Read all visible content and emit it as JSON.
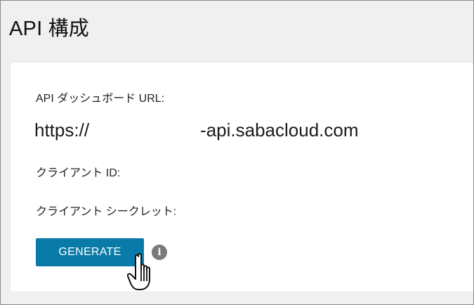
{
  "page": {
    "title": "API 構成"
  },
  "card": {
    "api_dashboard_url_label": "API ダッシュボード URL:",
    "api_dashboard_url_prefix": "https://",
    "api_dashboard_url_suffix": "-api.sabacloud.com",
    "client_id_label": "クライアント ID:",
    "client_secret_label": "クライアント シークレット:"
  },
  "actions": {
    "generate_label": "GENERATE"
  },
  "icons": {
    "info": "info-icon",
    "cursor": "hand-pointer-icon"
  },
  "colors": {
    "page_background": "#f0f0f0",
    "card_background": "#ffffff",
    "button_background": "#0a7aa8",
    "button_text": "#ffffff",
    "info_icon": "#7a7a7a"
  }
}
